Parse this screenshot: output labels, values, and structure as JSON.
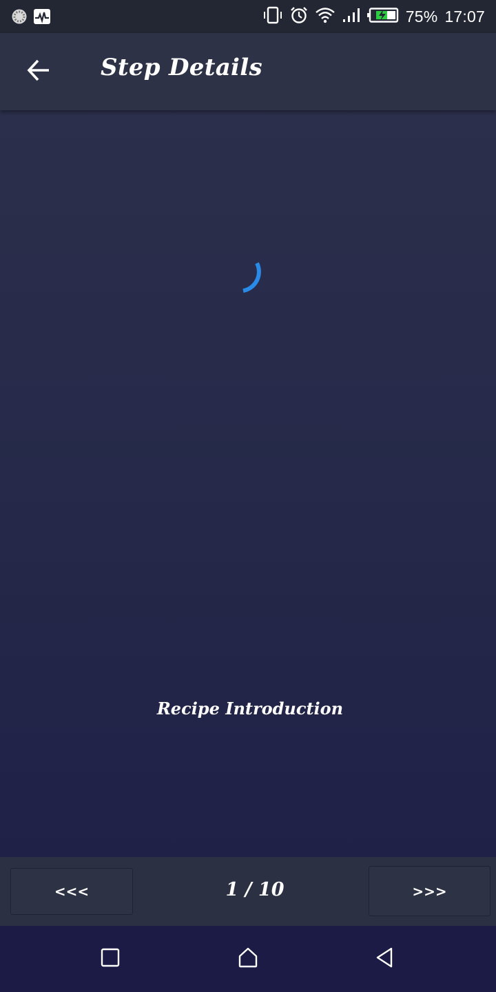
{
  "status_bar": {
    "battery_percent": "75%",
    "time": "17:07",
    "icons_left": [
      "app-notification-icon",
      "activity-monitor-icon"
    ],
    "icons_right": [
      "vibrate-icon",
      "alarm-icon",
      "wifi-icon",
      "signal-icon",
      "battery-charging-icon"
    ]
  },
  "toolbar": {
    "back_icon": "arrow-left-icon",
    "title": "Step Details"
  },
  "content": {
    "loading_indicator": "loading-spinner",
    "caption": "Recipe Introduction"
  },
  "pager": {
    "prev_label": "<<<",
    "next_label": ">>>",
    "counter": "1 / 10"
  },
  "system_nav": {
    "icons": [
      "recents-square-icon",
      "home-icon",
      "back-triangle-icon"
    ]
  },
  "colors": {
    "accent": "#2a8ae8",
    "toolbar": "#2e3246",
    "status_bar": "#232633",
    "system_nav": "#1b1b45"
  }
}
